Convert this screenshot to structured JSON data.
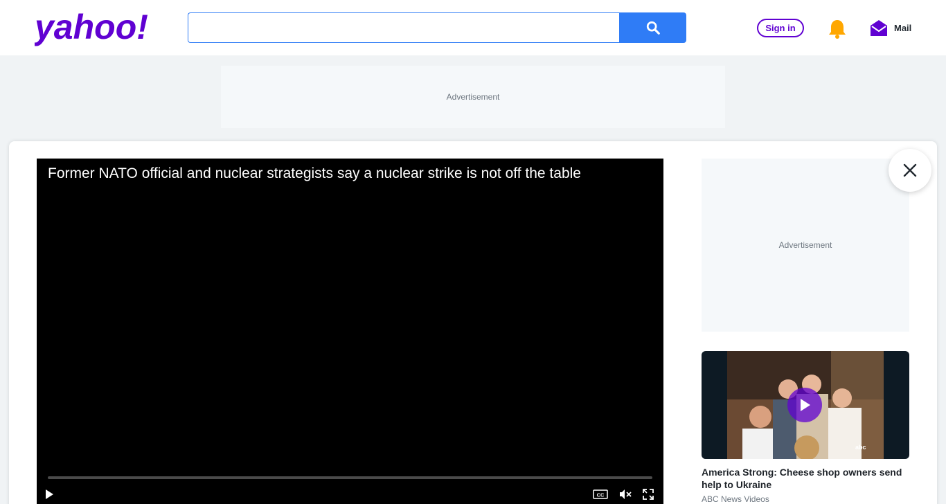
{
  "header": {
    "logo_text": "yahoo!",
    "search": {
      "value": "",
      "placeholder": ""
    },
    "signin_label": "Sign in",
    "mail_label": "Mail"
  },
  "ads": {
    "top_label": "Advertisement",
    "side_label": "Advertisement"
  },
  "video": {
    "title": "Former NATO official and nuclear strategists say a nuclear strike is not off the table",
    "progress": 0,
    "muted": true
  },
  "recommended": {
    "title": "America Strong: Cheese shop owners send help to Ukraine",
    "source": "ABC News Videos",
    "badge": "abc"
  },
  "colors": {
    "brand": "#6001d2",
    "accent": "#2f7cf6",
    "bell": "#ffa700"
  },
  "icons": [
    "search-icon",
    "bell-icon",
    "mail-icon",
    "close-icon",
    "play-icon",
    "closed-captions-icon",
    "mute-icon",
    "fullscreen-icon"
  ]
}
